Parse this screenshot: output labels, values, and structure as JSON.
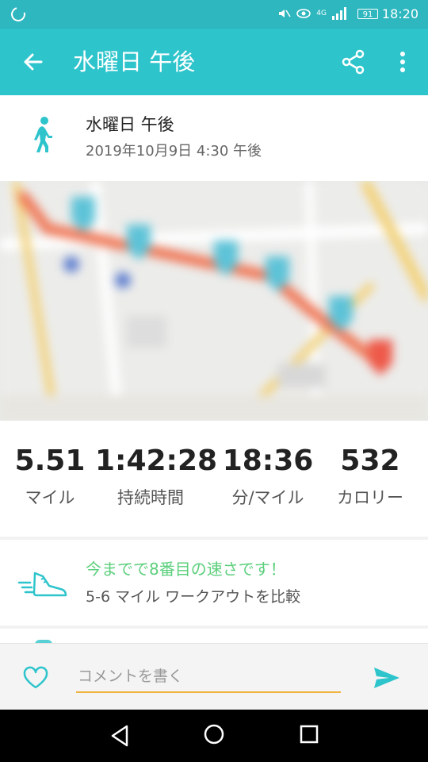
{
  "status_bar": {
    "time": "18:20",
    "battery": "91",
    "network": "4G"
  },
  "app_bar": {
    "title": "水曜日 午後",
    "back_icon": "arrow-left-icon",
    "share_icon": "share-icon",
    "more_icon": "more-vert-icon"
  },
  "activity": {
    "type_icon": "walking-icon",
    "title": "水曜日 午後",
    "datetime": "2019年10月9日 4:30 午後"
  },
  "stats": [
    {
      "value": "5.51",
      "label": "マイル"
    },
    {
      "value": "1:42:28",
      "label": "持続時間"
    },
    {
      "value": "18:36",
      "label": "分/マイル"
    },
    {
      "value": "532",
      "label": "カロリー"
    }
  ],
  "comparison": {
    "icon": "running-shoe-icon",
    "headline": "今までで8番目の速さです！",
    "subtitle": "5-6 マイル ワークアウトを比較"
  },
  "comment": {
    "placeholder": "コメントを書く",
    "value": "",
    "like_icon": "heart-icon",
    "send_icon": "send-icon"
  },
  "colors": {
    "primary": "#2ec4cc",
    "status_bar": "#2eb7bf",
    "accent_green": "#5ccf7c",
    "input_underline": "#f0b440"
  }
}
